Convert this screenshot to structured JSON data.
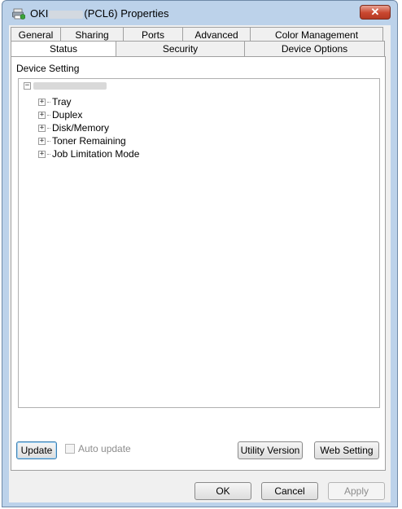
{
  "window": {
    "title_prefix": "OKI",
    "title_suffix": "(PCL6) Properties",
    "close_glyph": "✕"
  },
  "tabs": {
    "back_row": [
      "General",
      "Sharing",
      "Ports",
      "Advanced",
      "Color Management"
    ],
    "front_row": [
      "Status",
      "Security",
      "Device Options"
    ],
    "active": "Status"
  },
  "status_panel": {
    "section_label": "Device Setting",
    "tree": {
      "root_expander": "−",
      "items": [
        {
          "expander": "+",
          "label": "Tray"
        },
        {
          "expander": "+",
          "label": "Duplex"
        },
        {
          "expander": "+",
          "label": "Disk/Memory"
        },
        {
          "expander": "+",
          "label": "Toner Remaining"
        },
        {
          "expander": "+",
          "label": "Job Limitation Mode"
        }
      ]
    },
    "update_button": "Update",
    "auto_update_label": "Auto update",
    "auto_update_checked": false,
    "utility_version_button": "Utility Version",
    "web_setting_button": "Web Setting"
  },
  "dialog_buttons": {
    "ok": "OK",
    "cancel": "Cancel",
    "apply": "Apply"
  },
  "colors": {
    "frame": "#bcd2ea",
    "client": "#f0f0f0",
    "close_button": "#c9472f",
    "focus_border": "#3c7fb1"
  },
  "icons": {
    "app_icon": "printer-icon",
    "close_icon": "close-icon"
  }
}
